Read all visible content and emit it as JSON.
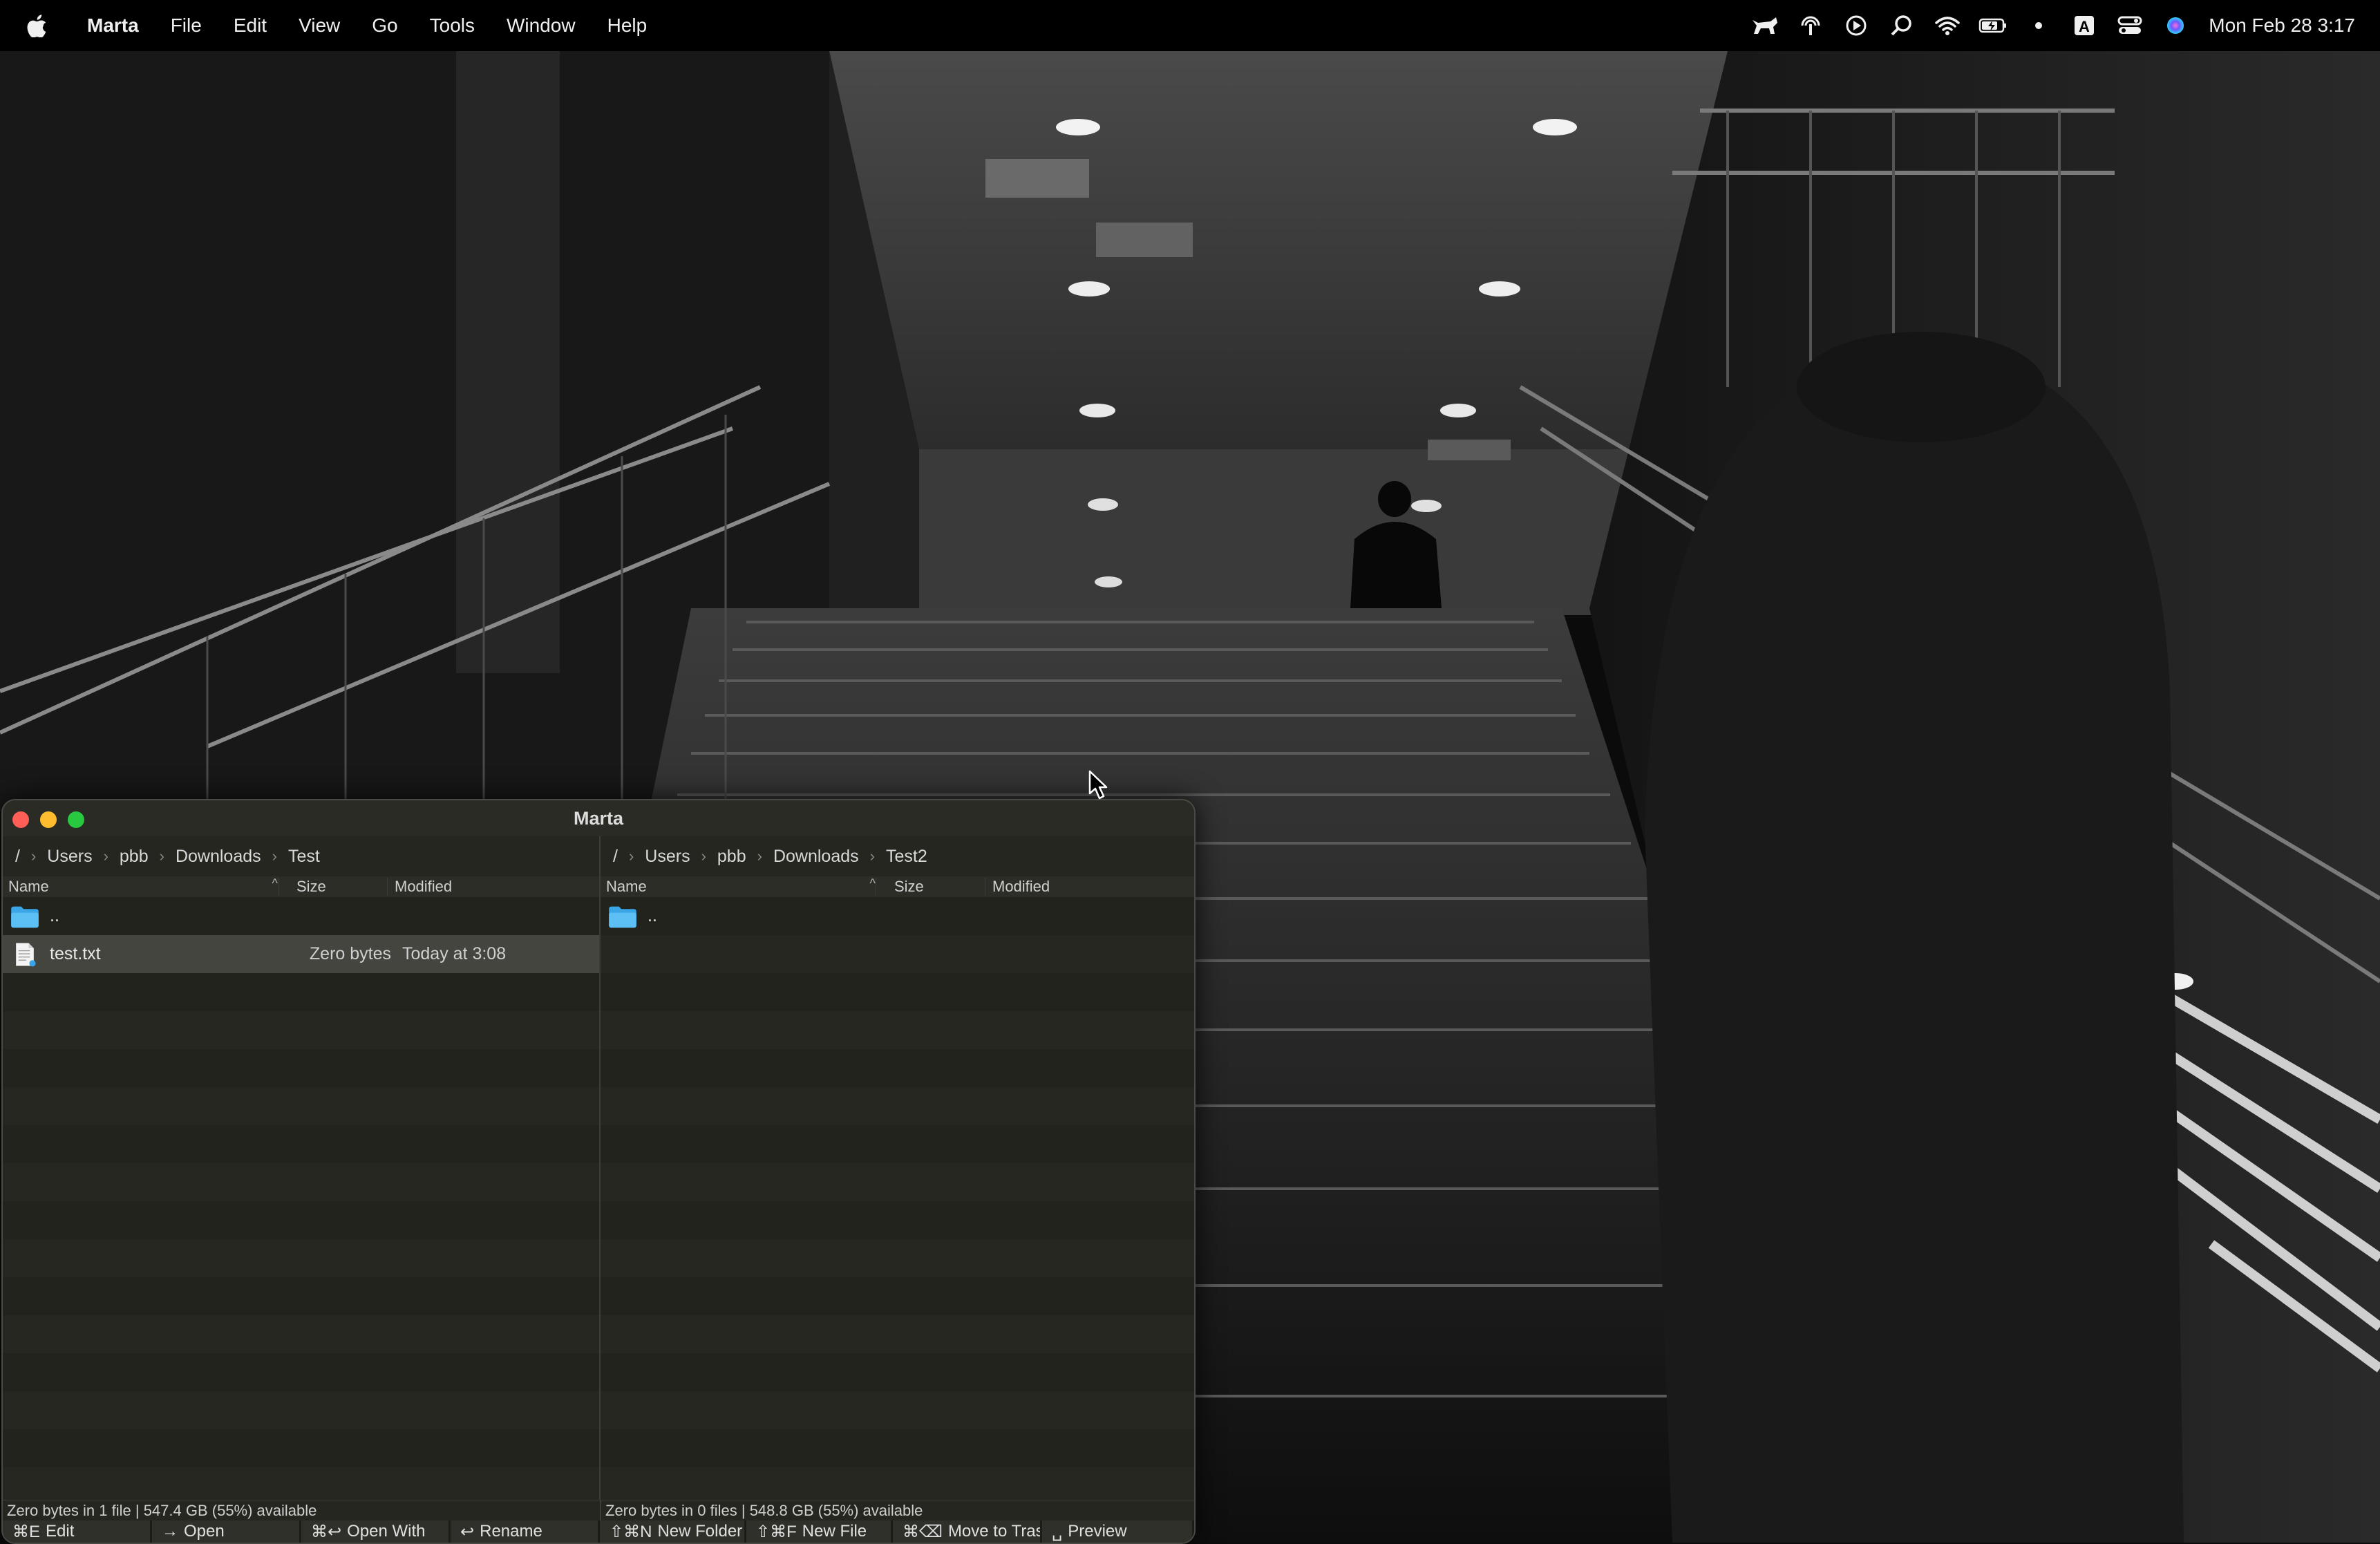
{
  "menubar": {
    "apple_icon": "apple-logo-icon",
    "app_name": "Marta",
    "items": [
      "File",
      "Edit",
      "View",
      "Go",
      "Tools",
      "Window",
      "Help"
    ],
    "status_icons": [
      "cat-app-icon",
      "airdrop-icon",
      "play-icon",
      "search-zoom-icon",
      "wifi-icon",
      "battery-icon",
      "dot-icon",
      "input-source-icon",
      "control-center-icon",
      "siri-icon"
    ],
    "input_source_letter": "A",
    "clock": "Mon Feb 28  3:17"
  },
  "window": {
    "title": "Marta",
    "colors": {
      "close": "#ff5f57",
      "minimize": "#febc2e",
      "zoom": "#28c840",
      "folder": "#3aa6e8"
    }
  },
  "left_pane": {
    "breadcrumb": [
      "/",
      "Users",
      "pbb",
      "Downloads",
      "Test"
    ],
    "columns": {
      "name": "Name",
      "size": "Size",
      "modified": "Modified"
    },
    "rows": [
      {
        "icon": "folder-icon",
        "name": "..",
        "size": "",
        "modified": ""
      },
      {
        "icon": "text-file-icon",
        "name": "test.txt",
        "size": "Zero bytes",
        "modified": "Today at 3:08"
      }
    ],
    "status": "Zero bytes in 1 file  |  547.4 GB (55%) available"
  },
  "right_pane": {
    "breadcrumb": [
      "/",
      "Users",
      "pbb",
      "Downloads",
      "Test2"
    ],
    "columns": {
      "name": "Name",
      "size": "Size",
      "modified": "Modified"
    },
    "rows": [
      {
        "icon": "folder-icon",
        "name": "..",
        "size": "",
        "modified": ""
      }
    ],
    "status": "Zero bytes in 0 files  |  548.8 GB (55%) available"
  },
  "toolbar": [
    {
      "key": "⌘E",
      "label": "Edit"
    },
    {
      "key": "→",
      "label": "Open"
    },
    {
      "key": "⌘↩",
      "label": "Open With"
    },
    {
      "key": "↩",
      "label": "Rename"
    },
    {
      "key": "⇧⌘N",
      "label": "New Folder"
    },
    {
      "key": "⇧⌘F",
      "label": "New File"
    },
    {
      "key": "⌘⌫",
      "label": "Move to Trash"
    },
    {
      "key": "␣",
      "label": "Preview"
    }
  ]
}
